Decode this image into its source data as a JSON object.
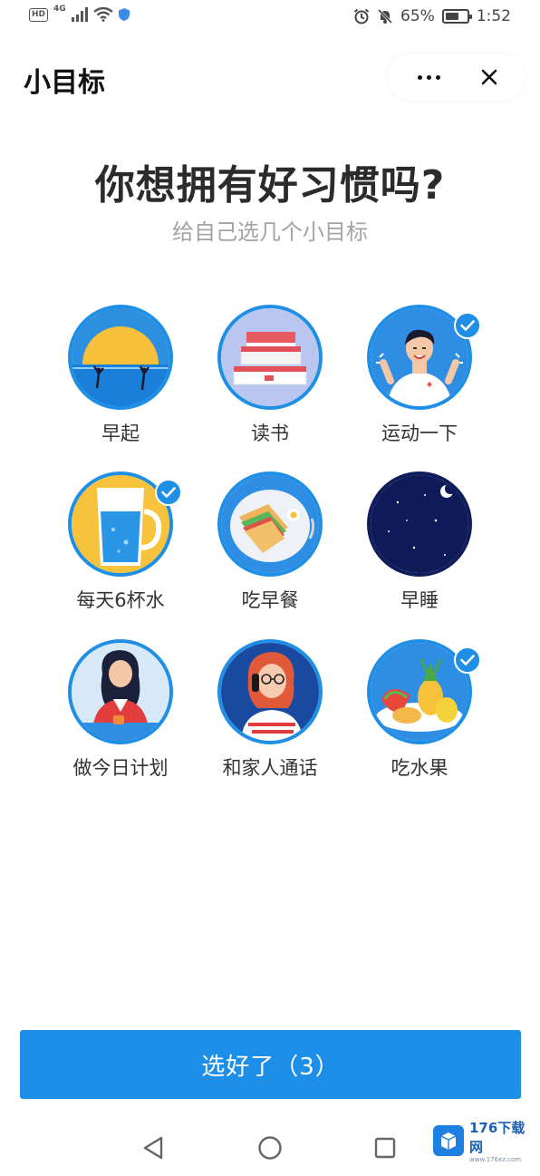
{
  "status_bar": {
    "hd": "HD",
    "network": "4G",
    "battery_percent_text": "65%",
    "battery_level": 0.65,
    "time": "1:52"
  },
  "header": {
    "title": "小目标"
  },
  "intro": {
    "heading": "你想拥有好习惯吗?",
    "subheading": "给自己选几个小目标"
  },
  "goals": [
    {
      "label": "早起",
      "selected": false,
      "illustration": "sunrise-illustration"
    },
    {
      "label": "读书",
      "selected": false,
      "illustration": "books-illustration"
    },
    {
      "label": "运动一下",
      "selected": true,
      "illustration": "exercise-illustration"
    },
    {
      "label": "每天6杯水",
      "selected": true,
      "illustration": "water-glass-illustration"
    },
    {
      "label": "吃早餐",
      "selected": false,
      "illustration": "breakfast-illustration"
    },
    {
      "label": "早睡",
      "selected": false,
      "illustration": "night-sky-illustration"
    },
    {
      "label": "做今日计划",
      "selected": false,
      "illustration": "planning-illustration"
    },
    {
      "label": "和家人通话",
      "selected": false,
      "illustration": "phone-call-illustration"
    },
    {
      "label": "吃水果",
      "selected": true,
      "illustration": "fruit-illustration"
    }
  ],
  "confirm": {
    "label": "选好了（3）"
  },
  "watermark": {
    "main": "176下载网",
    "sub": "www.176xz.com"
  },
  "colors": {
    "accent": "#1e8fe8",
    "heading": "#2b2b2b",
    "subheading": "#a3a3a3"
  }
}
